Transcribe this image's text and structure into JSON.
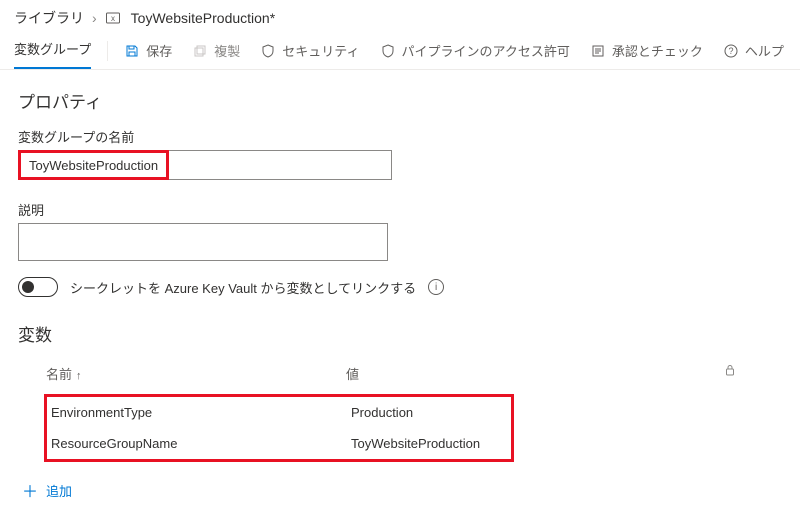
{
  "breadcrumb": {
    "root": "ライブラリ",
    "current": "ToyWebsiteProduction*"
  },
  "toolbar": {
    "tab": "変数グループ",
    "save": "保存",
    "clone": "複製",
    "security": "セキュリティ",
    "pipeline_perm": "パイプラインのアクセス許可",
    "approvals": "承認とチェック",
    "help": "ヘルプ"
  },
  "properties": {
    "section_title": "プロパティ",
    "name_label": "変数グループの名前",
    "name_value": "ToyWebsiteProduction",
    "description_label": "説明",
    "description_value": "",
    "kv_toggle_label": "シークレットを Azure Key Vault から変数としてリンクする"
  },
  "variables": {
    "section_title": "変数",
    "col_name": "名前",
    "col_value": "値",
    "rows": [
      {
        "name": "EnvironmentType",
        "value": "Production"
      },
      {
        "name": "ResourceGroupName",
        "value": "ToyWebsiteProduction"
      }
    ],
    "add_label": "追加"
  }
}
